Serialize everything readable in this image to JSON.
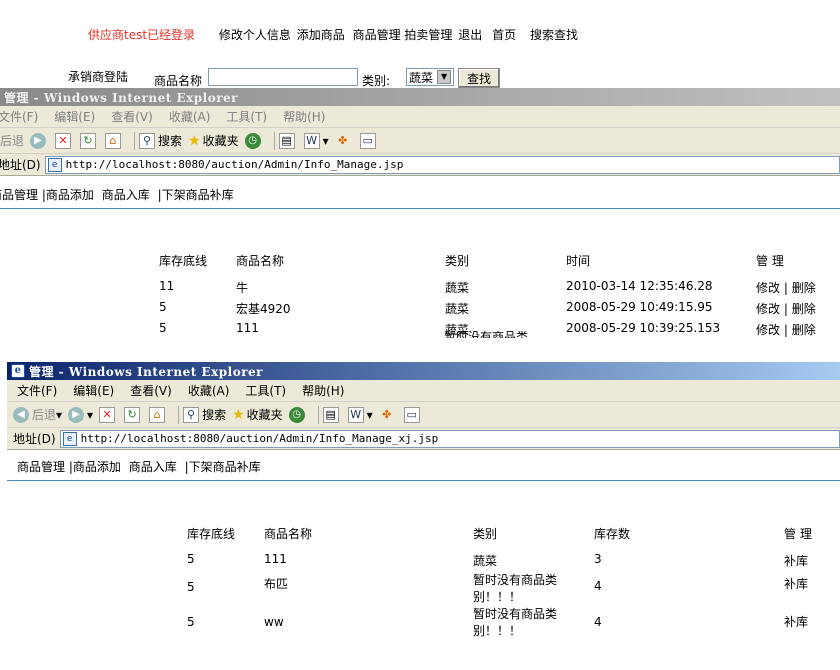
{
  "top_page": {
    "welcome": "供应商test已经登录",
    "nav": [
      "修改个人信息",
      "添加商品",
      "商品管理",
      "拍卖管理",
      "退出",
      "首页",
      "搜索查找"
    ],
    "login_label": "承销商登陆",
    "name_label": "商品名称",
    "name_value": "",
    "category_label": "类别:",
    "category_value": "蔬菜",
    "search_button": "查找"
  },
  "window1": {
    "title": "管理 - Windows Internet Explorer",
    "menu": [
      "文件(F)",
      "编辑(E)",
      "查看(V)",
      "收藏(A)",
      "工具(T)",
      "帮助(H)"
    ],
    "toolbar": {
      "back": "后退",
      "search": "搜索",
      "favorites": "收藏夹"
    },
    "address_label": "地址(D)",
    "url": "http://localhost:8080/auction/Admin/Info_Manage.jsp",
    "nav": [
      "商品管理",
      "|商品添加",
      "商品入库",
      "|下架商品补库"
    ],
    "columns": [
      "库存底线",
      "商品名称",
      "类别",
      "时间",
      "管 理"
    ],
    "rows": [
      {
        "min": "11",
        "name": "牛",
        "category": "蔬菜",
        "time": "2010-03-14 12:35:46.28"
      },
      {
        "min": "5",
        "name": "宏基4920",
        "category": "蔬菜",
        "time": "2008-05-29 10:49:15.95"
      },
      {
        "min": "5",
        "name": "111",
        "category": "蔬菜",
        "time": "2008-05-29 10:39:25.153"
      }
    ],
    "edit": "修改",
    "delete": "删除",
    "overflow_text": "暂时没有商品类"
  },
  "window2": {
    "title": "管理 - Windows Internet Explorer",
    "menu": [
      "文件(F)",
      "编辑(E)",
      "查看(V)",
      "收藏(A)",
      "工具(T)",
      "帮助(H)"
    ],
    "toolbar": {
      "back": "后退",
      "search": "搜索",
      "favorites": "收藏夹"
    },
    "address_label": "地址(D)",
    "url": "http://localhost:8080/auction/Admin/Info_Manage_xj.jsp",
    "nav": [
      "商品管理",
      "|商品添加",
      "商品入库",
      "|下架商品补库"
    ],
    "columns": [
      "库存底线",
      "商品名称",
      "类别",
      "库存数",
      "管 理"
    ],
    "rows": [
      {
        "min": "5",
        "name": "111",
        "category": "蔬菜",
        "category2": "",
        "stock": "3",
        "action": "补库"
      },
      {
        "min": "5",
        "name": "布匹",
        "category": "暂时没有商品类",
        "category2": "别！！！",
        "stock": "4",
        "action": "补库"
      },
      {
        "min": "5",
        "name": "ww",
        "category": "暂时没有商品类",
        "category2": "别！！！",
        "stock": "4",
        "action": "补库"
      }
    ]
  },
  "colors": {
    "welcome": "#e0302a",
    "active_title": "#0a246a",
    "rule": "#4a90c8"
  }
}
